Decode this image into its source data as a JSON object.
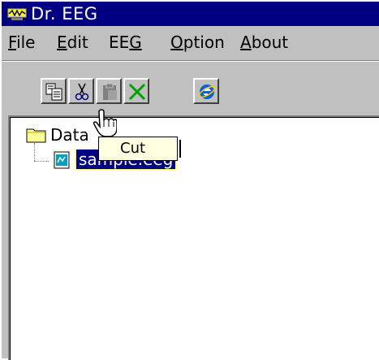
{
  "window": {
    "title": "Dr. EEG",
    "title_bar_color": "#000080",
    "icon": "dr-eeg-app-icon"
  },
  "menu": {
    "items": [
      {
        "label": "File",
        "mnemonic": "F"
      },
      {
        "label": "Edit",
        "mnemonic": "E"
      },
      {
        "label": "EEG",
        "mnemonic": "G"
      },
      {
        "label": "Option",
        "mnemonic": "O"
      },
      {
        "label": "About",
        "mnemonic": "A"
      }
    ]
  },
  "toolbar": {
    "buttons": [
      {
        "name": "copy",
        "icon": "copy-icon"
      },
      {
        "name": "cut",
        "icon": "scissors-icon"
      },
      {
        "name": "paste",
        "icon": "clipboard-icon"
      },
      {
        "name": "delete",
        "icon": "green-x-icon"
      },
      {
        "name": "web",
        "icon": "internet-explorer-icon"
      }
    ]
  },
  "tree": {
    "folder_label": "Data",
    "file_label": "sample.eeg",
    "selected_color": "#000080"
  },
  "tooltip": {
    "text": "Cut"
  }
}
